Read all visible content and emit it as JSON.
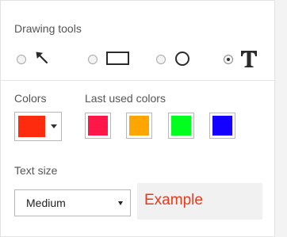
{
  "drawing_tools": {
    "label": "Drawing tools",
    "tools": [
      {
        "name": "pointer",
        "icon": "arrow-pointer-icon",
        "selected": false
      },
      {
        "name": "rectangle",
        "icon": "rectangle-icon",
        "selected": false
      },
      {
        "name": "circle",
        "icon": "circle-icon",
        "selected": false
      },
      {
        "name": "text",
        "icon": "text-icon",
        "glyph": "T",
        "selected": true
      }
    ]
  },
  "colors": {
    "label": "Colors",
    "current": "#ff2b0f"
  },
  "last_used_colors": {
    "label": "Last used colors",
    "swatches": [
      "#ff1749",
      "#ffa500",
      "#00ff1e",
      "#1400ff"
    ]
  },
  "text_size": {
    "label": "Text size",
    "selected": "Medium"
  },
  "example": {
    "text": "Example",
    "color": "#e8391d"
  }
}
